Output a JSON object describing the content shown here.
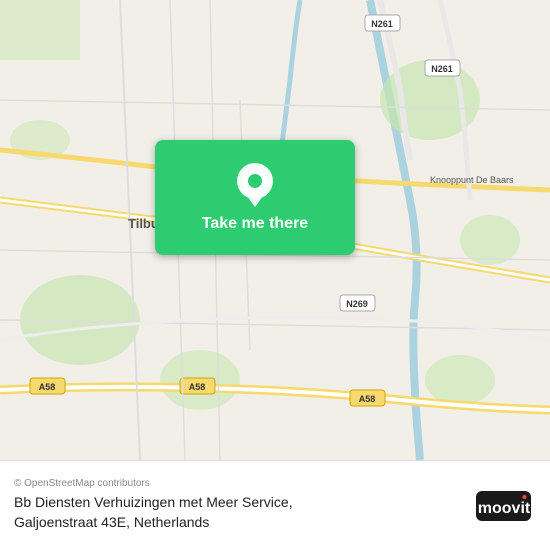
{
  "map": {
    "location_name": "Tilburg",
    "nearby_label_1": "Knooppunt De Baars",
    "road_labels": [
      "N261",
      "N261",
      "A58",
      "A58",
      "A58",
      "N269"
    ],
    "take_me_there": "Take me there",
    "pin_color": "#ffffff",
    "card_color": "#2ecc71"
  },
  "footer": {
    "osm_credit": "© OpenStreetMap contributors",
    "address_line1": "Bb Diensten Verhuizingen met Meer Service,",
    "address_line2": "Galjoenstraat 43E, Netherlands",
    "logo_text": "moovit",
    "logo_dot_char": "·"
  }
}
